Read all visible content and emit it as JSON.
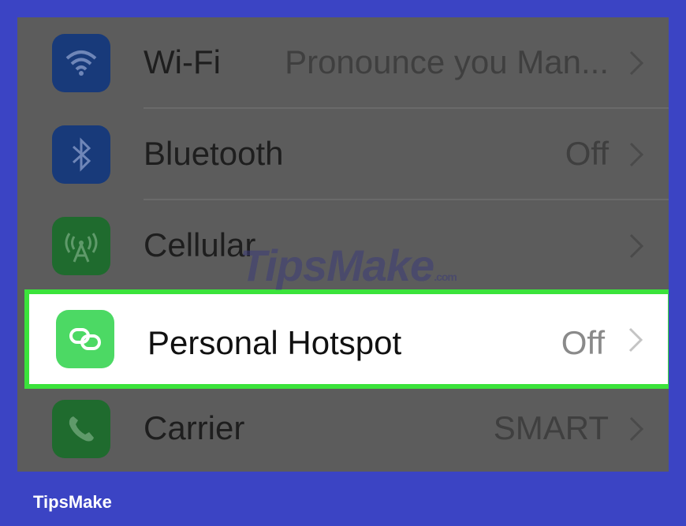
{
  "settings": {
    "rows": [
      {
        "label": "Wi-Fi",
        "value": "Pronounce you Man...",
        "icon": "wifi-icon",
        "icon_color": "#183a7a"
      },
      {
        "label": "Bluetooth",
        "value": "Off",
        "icon": "bluetooth-icon",
        "icon_color": "#183a7a"
      },
      {
        "label": "Cellular",
        "value": "",
        "icon": "cellular-antenna-icon",
        "icon_color": "#1f6b2e"
      },
      {
        "label": "Personal Hotspot",
        "value": "Off",
        "icon": "hotspot-link-icon",
        "icon_color": "#4cd964",
        "highlighted": true
      },
      {
        "label": "Carrier",
        "value": "SMART",
        "icon": "phone-icon",
        "icon_color": "#1f6b2e"
      }
    ]
  },
  "watermark": {
    "text": "TipsMake",
    "suffix": ".com"
  },
  "footer": {
    "brand": "TipsMake"
  },
  "colors": {
    "background_border": "#3b44c4",
    "highlight_border": "#3be33b",
    "dim_overlay": "#5c5c5c"
  }
}
